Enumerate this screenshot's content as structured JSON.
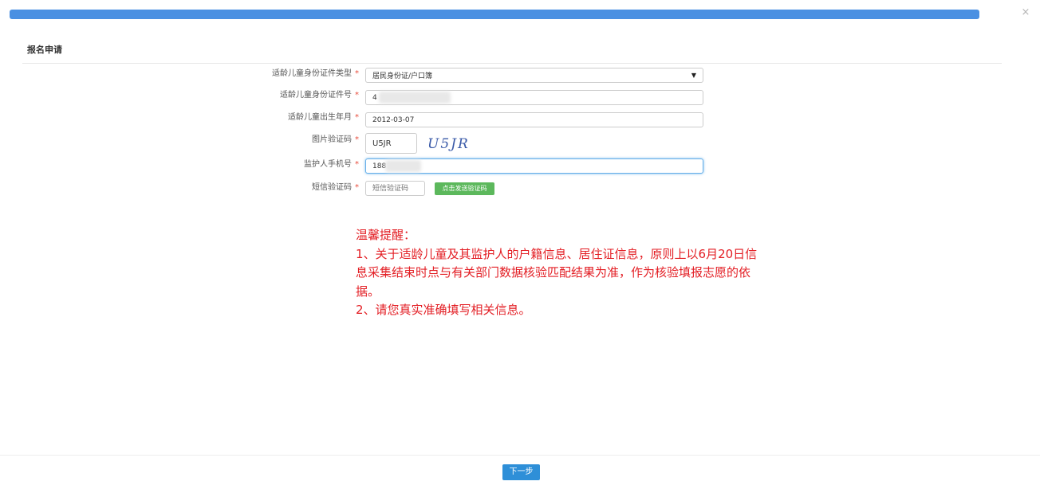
{
  "header": {
    "close_symbol": "×"
  },
  "form": {
    "title": "报名申请",
    "required_mark": "*",
    "id_type": {
      "label": "适龄儿童身份证件类型",
      "value": "居民身份证/户口簿",
      "caret": "▼"
    },
    "id_number": {
      "label": "适龄儿童身份证件号",
      "value": "4"
    },
    "birth_date": {
      "label": "适龄儿童出生年月",
      "value": "2012-03-07"
    },
    "captcha": {
      "label": "图片验证码",
      "value": "U5JR",
      "image_text": "U5JR"
    },
    "guardian_phone": {
      "label": "监护人手机号",
      "value": "188"
    },
    "sms_code": {
      "label": "短信验证码",
      "placeholder": "短信验证码",
      "send_button": "点击发送验证码"
    }
  },
  "notice": {
    "heading": "温馨提醒：",
    "line1a": "1、关于适龄儿童及其监护人的户籍信息、居住证信息，原则上以6月20日信",
    "line1b": "息采集结束时点与有关部门数据核验匹配结果为准，作为核验填报志愿的依",
    "line1c": "据。",
    "line2": "2、请您真实准确填写相关信息。"
  },
  "footer": {
    "next_button": "下一步"
  },
  "colors": {
    "top_bar": "#4a90e2",
    "required": "#e74c3c",
    "notice_text": "#e31e24",
    "sms_button": "#5cb85c",
    "next_button": "#2e8fd8"
  },
  "icons": {
    "close": "close-icon",
    "select_caret": "caret-down-icon"
  }
}
